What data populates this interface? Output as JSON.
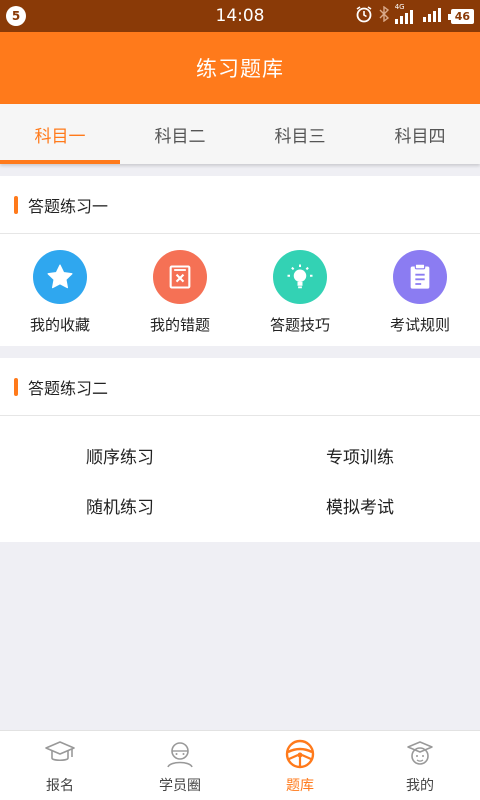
{
  "status": {
    "notification_count": "5",
    "time": "14:08",
    "network": "4G",
    "battery": "46"
  },
  "header": {
    "title": "练习题库"
  },
  "tabs": [
    {
      "label": "科目一",
      "active": true
    },
    {
      "label": "科目二",
      "active": false
    },
    {
      "label": "科目三",
      "active": false
    },
    {
      "label": "科目四",
      "active": false
    }
  ],
  "section1": {
    "title": "答题练习一",
    "items": [
      {
        "label": "我的收藏",
        "icon": "star-icon",
        "color": "#2fa7ef"
      },
      {
        "label": "我的错题",
        "icon": "wrong-question-icon",
        "color": "#f57155"
      },
      {
        "label": "答题技巧",
        "icon": "lightbulb-icon",
        "color": "#33d2b4"
      },
      {
        "label": "考试规则",
        "icon": "clipboard-icon",
        "color": "#8b7cf2"
      }
    ]
  },
  "section2": {
    "title": "答题练习二",
    "items": [
      {
        "label": "顺序练习"
      },
      {
        "label": "专项训练"
      },
      {
        "label": "随机练习"
      },
      {
        "label": "模拟考试"
      }
    ]
  },
  "bottom_nav": [
    {
      "label": "报名",
      "icon": "graduation-cap-icon",
      "active": false
    },
    {
      "label": "学员圈",
      "icon": "student-circle-icon",
      "active": false
    },
    {
      "label": "题库",
      "icon": "steering-wheel-icon",
      "active": true
    },
    {
      "label": "我的",
      "icon": "profile-icon",
      "active": false
    }
  ],
  "colors": {
    "accent": "#ff7a1b",
    "status_bar": "#8a3a07"
  }
}
